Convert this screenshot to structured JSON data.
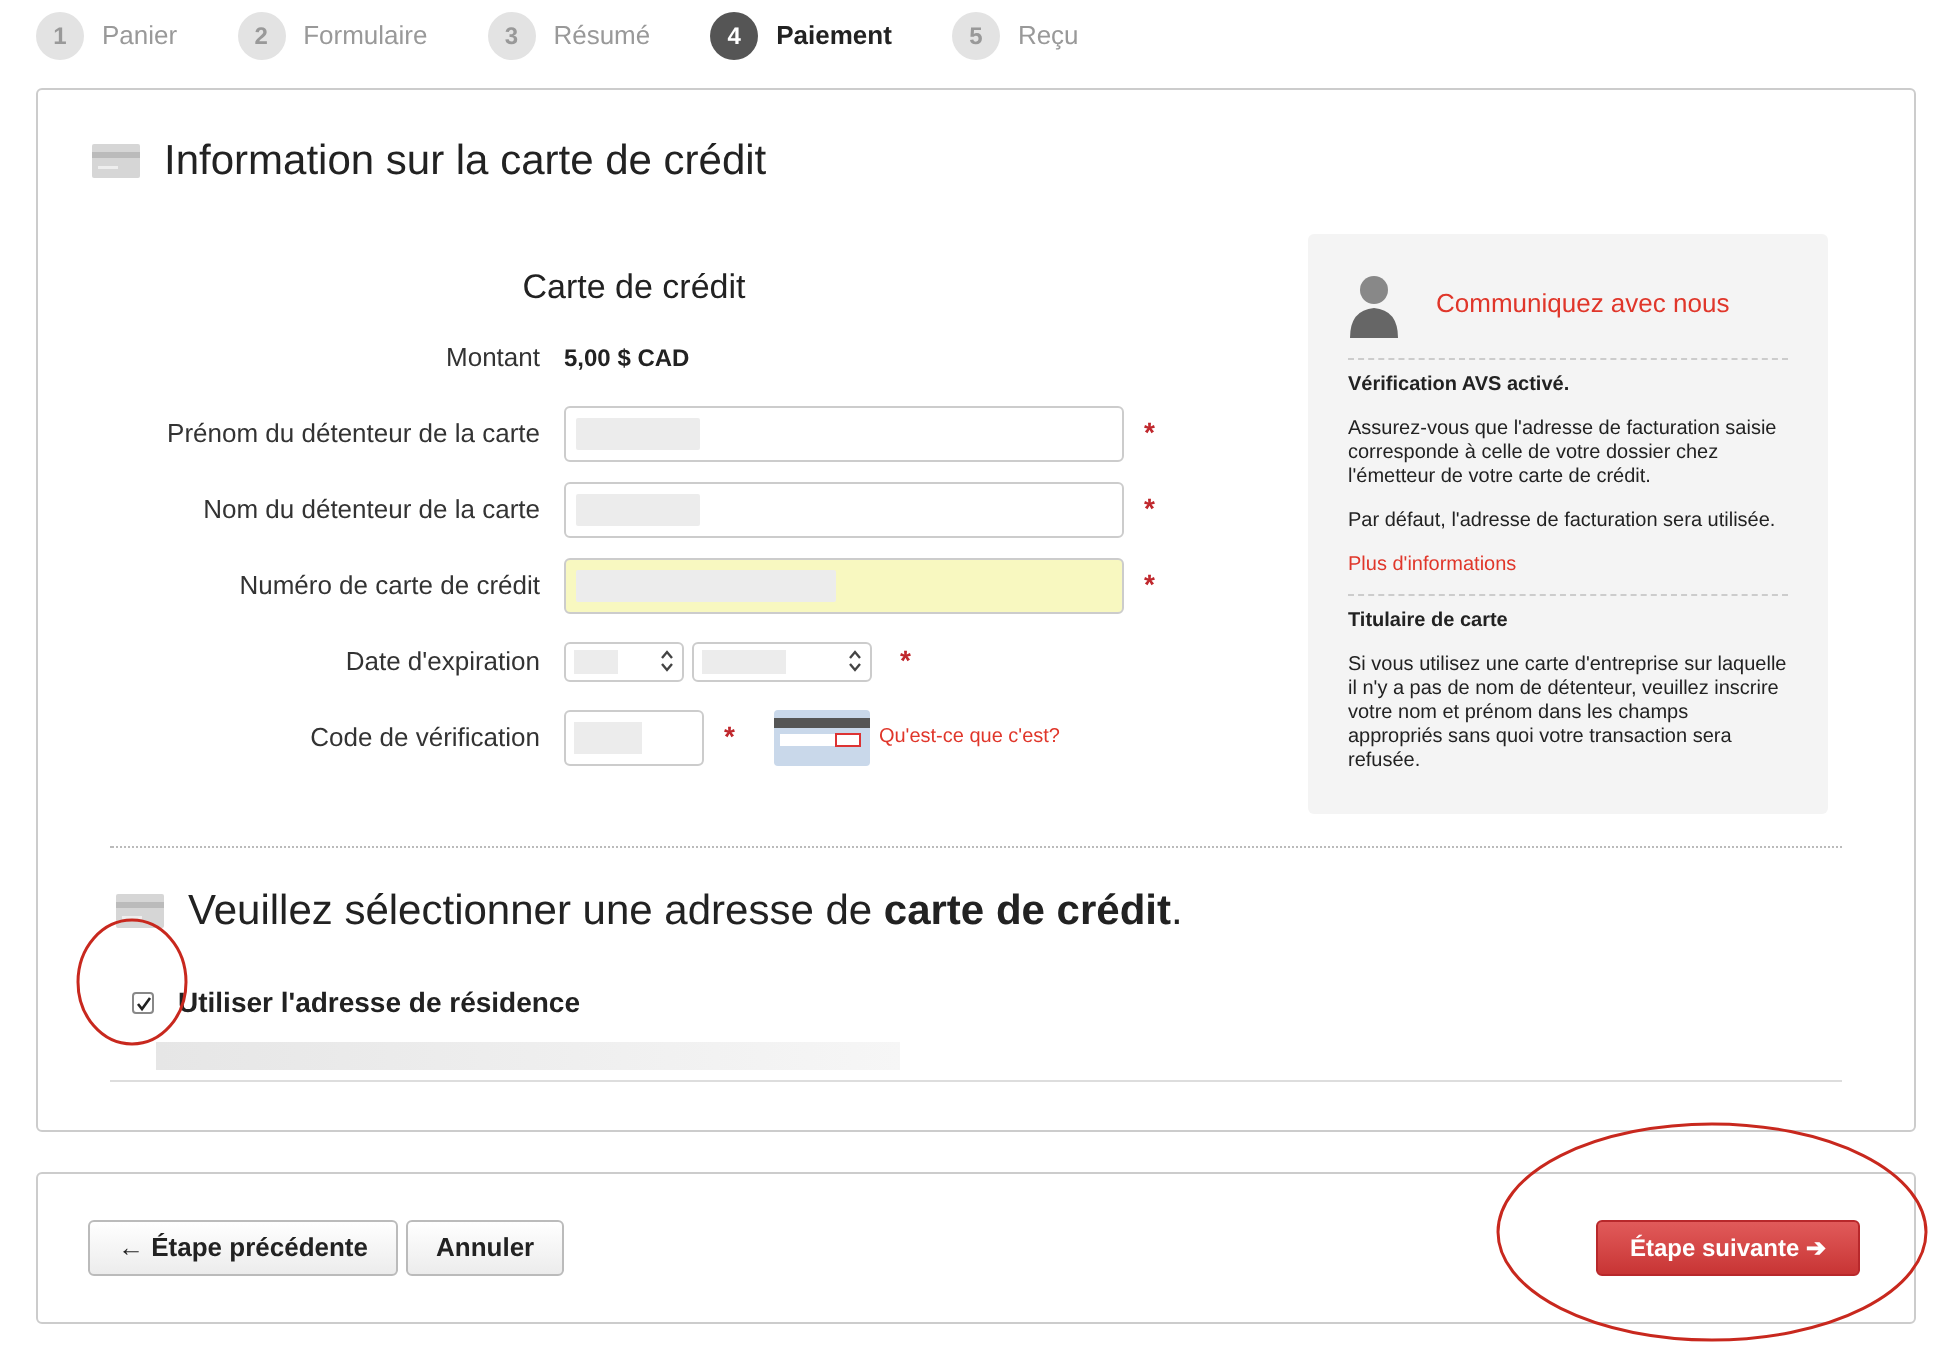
{
  "steps": [
    {
      "number": "1",
      "label": "Panier",
      "selected": false
    },
    {
      "number": "2",
      "label": "Formulaire",
      "selected": false
    },
    {
      "number": "3",
      "label": "Résumé",
      "selected": false
    },
    {
      "number": "4",
      "label": "Paiement",
      "selected": true
    },
    {
      "number": "5",
      "label": "Reçu",
      "selected": false
    }
  ],
  "card_section": {
    "title": "Information sur la carte de crédit",
    "form_title": "Carte de crédit",
    "amount": {
      "label": "Montant",
      "value": "5,00 $ CAD"
    },
    "fields": [
      {
        "kind": "text",
        "label": "Prénom du détenteur de la carte",
        "required_mark": "*",
        "highlighted": false
      },
      {
        "kind": "text",
        "label": "Nom du détenteur de la carte",
        "required_mark": "*",
        "highlighted": false
      },
      {
        "kind": "text",
        "label": "Numéro de carte de crédit",
        "required_mark": "*",
        "highlighted": true
      },
      {
        "kind": "date",
        "label": "Date d'expiration",
        "required_mark": "*",
        "highlighted": false
      },
      {
        "kind": "cvv",
        "label": "Code de vérification",
        "required_mark": "*",
        "highlighted": false,
        "help_link": "Qu'est-ce que c'est?"
      }
    ]
  },
  "sidebar": {
    "title": "Communiquez avec nous",
    "sections": [
      {
        "heading": "Vérification AVS activé.",
        "paragraphs": [
          "Assurez-vous que l'adresse de facturation saisie corresponde à celle de votre dossier chez l'émetteur de votre carte de crédit.",
          "Par défaut, l'adresse de facturation sera utilisée."
        ],
        "link": "Plus d'informations"
      },
      {
        "heading": "Titulaire de carte",
        "paragraphs": [
          "Si vous utilisez une carte d'entreprise sur laquelle il n'y a pas de nom de détenteur, veuillez inscrire votre nom et prénom dans les champs appropriés sans quoi votre transaction sera refusée."
        ]
      }
    ]
  },
  "address_section": {
    "title": "Veuillez sélectionner une adresse de **carte de crédit**.",
    "use_residence": {
      "label": "Utiliser l'adresse de résidence",
      "checked": true
    }
  },
  "buttons": [
    {
      "label": "← Étape précédente",
      "kind": "secondary"
    },
    {
      "label": "Annuler",
      "kind": "secondary"
    },
    {
      "label": "Étape suivante ➔",
      "kind": "primary"
    }
  ]
}
